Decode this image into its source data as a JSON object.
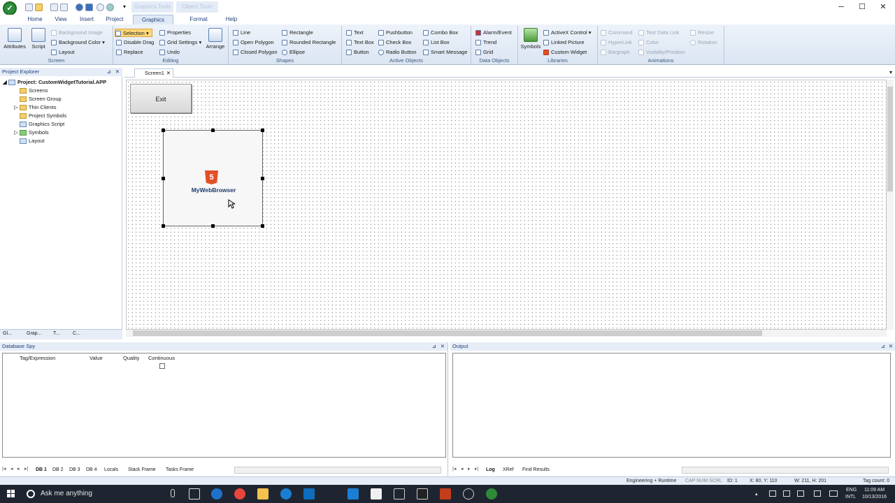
{
  "window": {
    "context_tabs": [
      "Graphics Tools",
      "Object Tools"
    ],
    "controls": {
      "minimize": "─",
      "maximize": "☐",
      "close": "✕"
    }
  },
  "ribbon_tabs": [
    "Home",
    "View",
    "Insert",
    "Project",
    "Graphics",
    "Format",
    "Help"
  ],
  "active_tab": "Graphics",
  "groups": {
    "screen": {
      "label": "Screen",
      "attributes": "Attributes",
      "script": "Script",
      "background_image": "Background Image",
      "background_color": "Background Color",
      "layout": "Layout"
    },
    "editing": {
      "label": "Editing",
      "selection": "Selection",
      "disable_drag": "Disable Drag",
      "replace": "Replace",
      "properties": "Properties",
      "grid_settings": "Grid Settings",
      "undo": "Undo",
      "arrange": "Arrange"
    },
    "shapes": {
      "label": "Shapes",
      "line": "Line",
      "open_polygon": "Open Polygon",
      "closed_polygon": "Closed Polygon",
      "rectangle": "Rectangle",
      "rounded_rectangle": "Rounded Rectangle",
      "ellipse": "Ellipse"
    },
    "active_objects": {
      "label": "Active Objects",
      "text": "Text",
      "text_box": "Text Box",
      "button": "Button",
      "pushbutton": "Pushbutton",
      "check_box": "Check Box",
      "radio_button": "Radio Button",
      "combo_box": "Combo Box",
      "list_box": "List Box",
      "smart_message": "Smart Message"
    },
    "data_objects": {
      "label": "Data Objects",
      "alarm_event": "Alarm/Event",
      "trend": "Trend",
      "grid": "Grid"
    },
    "libraries": {
      "label": "Libraries",
      "symbols": "Symbols",
      "activex_control": "ActiveX Control",
      "linked_picture": "Linked Picture",
      "custom_widget": "Custom Widget"
    },
    "animations": {
      "label": "Animations",
      "command": "Command",
      "hyperlink": "HyperLink",
      "bargraph": "Bargraph",
      "text_data_link": "Text Data Link",
      "color": "Color",
      "visibility_position": "Visibility/Position",
      "resize": "Resize",
      "rotation": "Rotation"
    }
  },
  "project_explorer": {
    "title": "Project Explorer",
    "root": "Project: CustomWidgetTutorial.APP",
    "items": [
      "Screens",
      "Screen Group",
      "Thin Clients",
      "Project Symbols",
      "Graphics Script",
      "Symbols",
      "Layout"
    ],
    "bottom_tabs": [
      "Gl...",
      "Grap...",
      "T...",
      "C..."
    ]
  },
  "editor": {
    "tab": "Screen1",
    "exit_button": "Exit",
    "widget_icon": "5",
    "widget_label": "MyWebBrowser"
  },
  "database_spy": {
    "title": "Database Spy",
    "columns": [
      "Tag/Expression",
      "Value",
      "Quality",
      "Continuous"
    ],
    "tabs": [
      "DB 1",
      "DB 2",
      "DB 3",
      "DB 4",
      "Locals",
      "Stack Frame",
      "Tasks Frame"
    ]
  },
  "output": {
    "title": "Output",
    "tabs": [
      "Log",
      "XRef",
      "Find Results"
    ]
  },
  "status_bar": {
    "mode": "Engineering + Runtime",
    "indicators": "CAP  NUM  SCRL",
    "id": "ID: 1",
    "coords": "X: 80, Y: 110",
    "size": "W: 211, H: 201",
    "tag_count": "Tag count: 0"
  },
  "taskbar": {
    "search_placeholder": "Ask me anything",
    "lang": "ENG",
    "locale": "INTL",
    "time": "11:09 AM",
    "date": "10/13/2016"
  }
}
